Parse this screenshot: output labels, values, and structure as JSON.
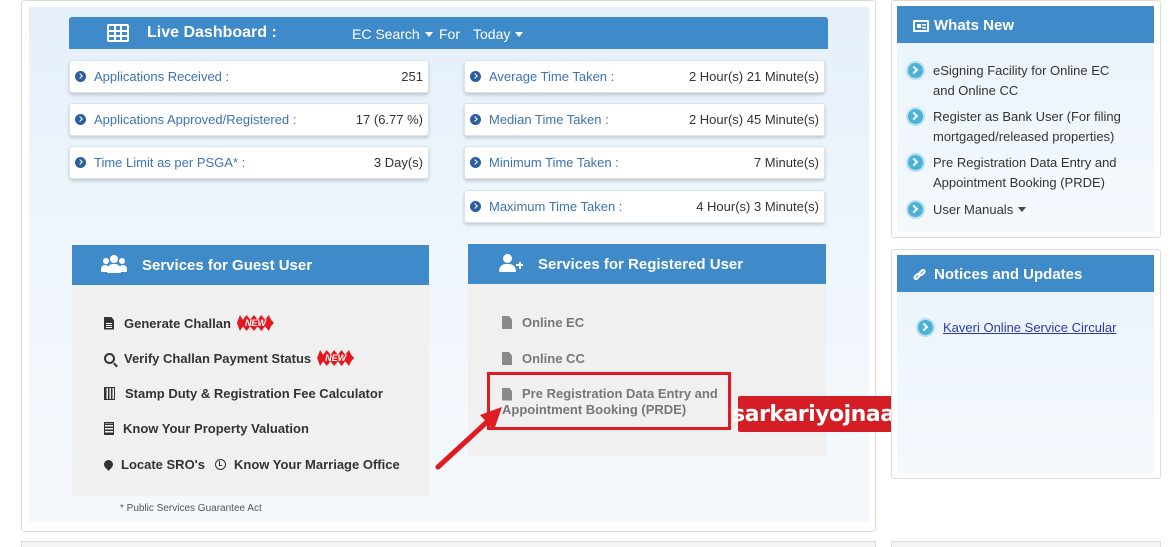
{
  "dashboard": {
    "title": "Live Dashboard :",
    "ec_search": "EC Search",
    "for_label": "For",
    "period": "Today",
    "left_stats": [
      {
        "label": "Applications Received :",
        "value": "251"
      },
      {
        "label": "Applications Approved/Registered :",
        "value": "17 (6.77 %)"
      },
      {
        "label": "Time Limit as per PSGA* :",
        "value": "3 Day(s)"
      }
    ],
    "right_stats": [
      {
        "label": "Average Time Taken :",
        "value": "2 Hour(s) 21 Minute(s)"
      },
      {
        "label": "Median Time Taken :",
        "value": "2 Hour(s) 45 Minute(s)"
      },
      {
        "label": "Minimum Time Taken :",
        "value": "7 Minute(s)"
      },
      {
        "label": "Maximum Time Taken :",
        "value": "4 Hour(s) 3 Minute(s)"
      }
    ]
  },
  "guest_services": {
    "title": "Services for Guest User",
    "generate_challan": "Generate Challan",
    "verify_challan": "Verify Challan Payment Status",
    "new_badge": "NEW",
    "stamp_duty": "Stamp Duty & Registration Fee Calculator",
    "property_valuation": "Know Your Property Valuation",
    "locate_sro": "Locate SRO's",
    "marriage_office": "Know Your Marriage Office"
  },
  "registered_services": {
    "title": "Services for Registered User",
    "online_ec": "Online EC",
    "online_cc": "Online CC",
    "prde_line1": "Pre Registration Data Entry and",
    "prde_line2": "Appointment Booking (PRDE)"
  },
  "footnote": "* Public Services Guarantee Act",
  "watermark": "sarkariyojnaa.com",
  "whats_new": {
    "title": "Whats New",
    "items": [
      {
        "line1": "eSigning Facility for Online EC",
        "line2": "and Online CC"
      },
      {
        "line1": "Register as Bank User (For filing",
        "line2": "mortgaged/released properties)"
      },
      {
        "line1": "Pre Registration Data Entry and",
        "line2": "Appointment Booking (PRDE)"
      }
    ],
    "user_manuals": "User Manuals"
  },
  "notices": {
    "title": "Notices and Updates",
    "link": "Kaveri Online Service Circular"
  },
  "colors": {
    "header_blue": "#3f8ac9",
    "label_blue": "#3d73b3",
    "highlight_red": "#e11b22"
  }
}
